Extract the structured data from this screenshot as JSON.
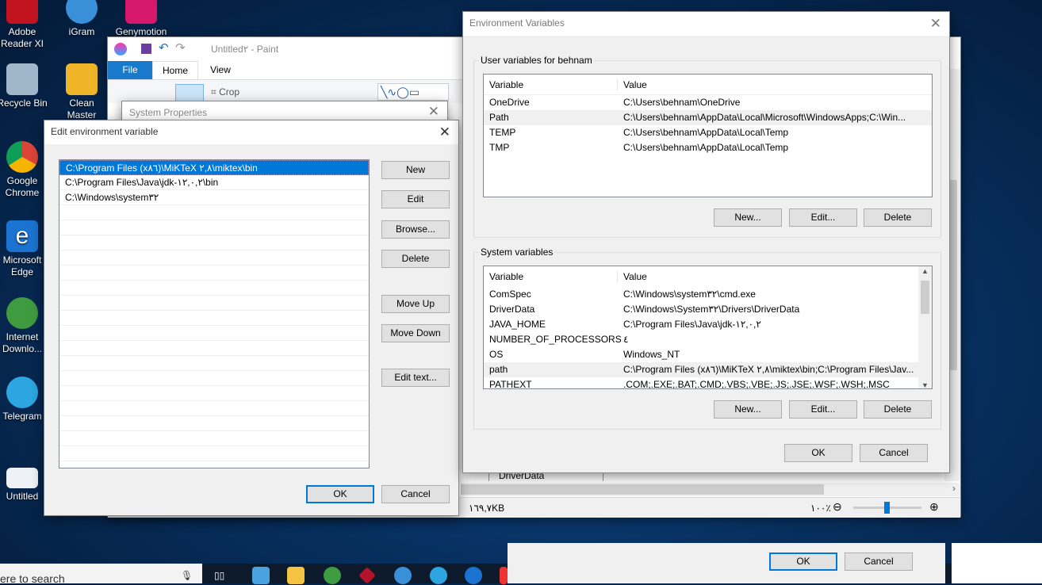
{
  "desktop": {
    "icons": [
      "Adobe Reader XI",
      "iGram",
      "Genymotion",
      "Recycle Bin",
      "Clean Master",
      "Google Chrome",
      "Microsoft Edge",
      "Internet Downlo...",
      "Telegram",
      "Untitled"
    ]
  },
  "paint": {
    "title": "Untitled٢ - Paint",
    "tabs": [
      "File",
      "Home",
      "View"
    ],
    "crop": "Crop",
    "status_size": "١٦٩,٧KB",
    "zoom": "١٠٠٪",
    "behind_item": "DriverData",
    "zoom_slider_fraction": 0.5
  },
  "system_properties": {
    "title": "System Properties"
  },
  "edit_env": {
    "title": "Edit environment variable",
    "items": [
      "C:\\Program Files (x٨٦)\\MiKTeX ٢,٨\\miktex\\bin",
      "C:\\Program Files\\Java\\jdk-١٢,٠,٢\\bin",
      "C:\\Windows\\system٣٢"
    ],
    "selected_index": 0,
    "buttons": {
      "new": "New",
      "edit": "Edit",
      "browse": "Browse...",
      "delete": "Delete",
      "move_up": "Move Up",
      "move_down": "Move Down",
      "edit_text": "Edit text...",
      "ok": "OK",
      "cancel": "Cancel"
    }
  },
  "env_vars": {
    "title": "Environment Variables",
    "user": {
      "label": "User variables for behnam",
      "headers": [
        "Variable",
        "Value"
      ],
      "rows": [
        [
          "OneDrive",
          "C:\\Users\\behnam\\OneDrive"
        ],
        [
          "Path",
          "C:\\Users\\behnam\\AppData\\Local\\Microsoft\\WindowsApps;C:\\Win..."
        ],
        [
          "TEMP",
          "C:\\Users\\behnam\\AppData\\Local\\Temp"
        ],
        [
          "TMP",
          "C:\\Users\\behnam\\AppData\\Local\\Temp"
        ]
      ],
      "selected_index": 1,
      "buttons": [
        "New...",
        "Edit...",
        "Delete"
      ]
    },
    "system": {
      "label": "System variables",
      "headers": [
        "Variable",
        "Value"
      ],
      "rows": [
        [
          "ComSpec",
          "C:\\Windows\\system٣٢\\cmd.exe"
        ],
        [
          "DriverData",
          "C:\\Windows\\System٣٢\\Drivers\\DriverData"
        ],
        [
          "JAVA_HOME",
          "C:\\Program Files\\Java\\jdk-١٢,٠,٢"
        ],
        [
          "NUMBER_OF_PROCESSORS",
          "٤"
        ],
        [
          "OS",
          "Windows_NT"
        ],
        [
          "path",
          "C:\\Program Files (x٨٦)\\MiKTeX ٢,٨\\miktex\\bin;C:\\Program Files\\Jav..."
        ],
        [
          "PATHEXT",
          ".COM;.EXE;.BAT;.CMD;.VBS;.VBE;.JS;.JSE;.WSF;.WSH;.MSC"
        ]
      ],
      "selected_index": 5,
      "buttons": [
        "New...",
        "Edit...",
        "Delete"
      ]
    },
    "ok": "OK",
    "cancel": "Cancel"
  },
  "back_dialog": {
    "ok": "OK",
    "cancel": "Cancel"
  },
  "taskbar": {
    "search_placeholder": "ere to search"
  }
}
